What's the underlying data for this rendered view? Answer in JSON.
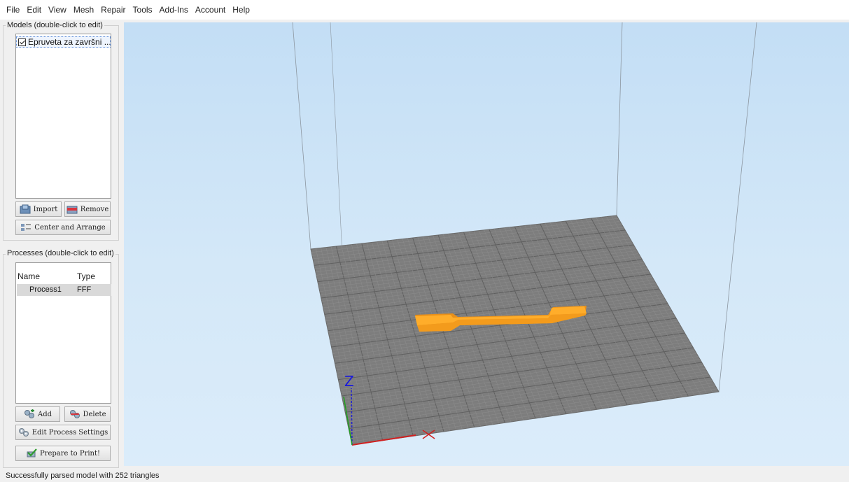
{
  "menu": [
    "File",
    "Edit",
    "View",
    "Mesh",
    "Repair",
    "Tools",
    "Add-Ins",
    "Account",
    "Help"
  ],
  "models": {
    "title": "Models (double-click to edit)",
    "items": [
      {
        "label": "Epruveta za završni ...",
        "checked": true
      }
    ],
    "buttons": {
      "import": "Import",
      "remove": "Remove",
      "center": "Center and Arrange"
    }
  },
  "processes": {
    "title": "Processes (double-click to edit)",
    "columns": [
      "Name",
      "Type"
    ],
    "rows": [
      {
        "name": "Process1",
        "type": "FFF"
      }
    ],
    "buttons": {
      "add": "Add",
      "delete": "Delete",
      "edit": "Edit Process Settings",
      "prepare": "Prepare to Print!"
    }
  },
  "viewport": {
    "axis_label": "Z",
    "bed_color": "#7d7d7d",
    "model_color": "#ffa51f",
    "sky_color": "#c9e2f6"
  },
  "status": "Successfully parsed model with 252 triangles"
}
